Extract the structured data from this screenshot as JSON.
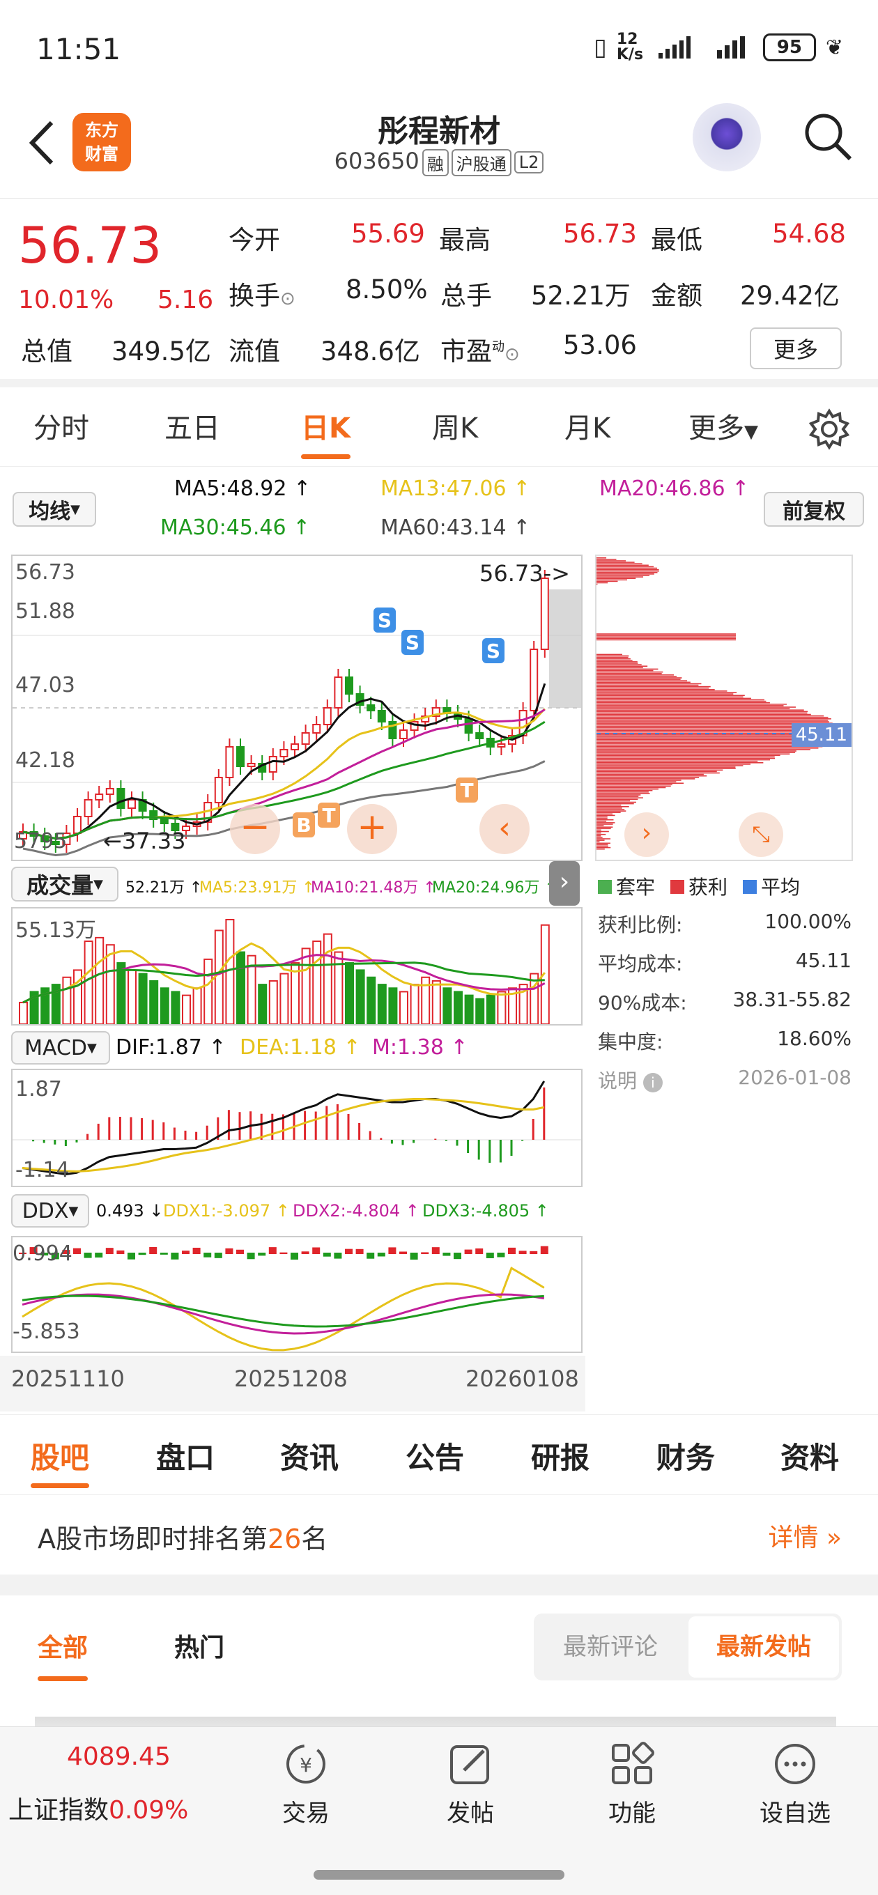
{
  "status": {
    "time": "11:51",
    "net_speed": "12 K/s",
    "battery": "95"
  },
  "header": {
    "logo_line1": "东方",
    "logo_line2": "财富",
    "name": "彤程新材",
    "code": "603650",
    "tags": [
      "融",
      "沪股通",
      "L2"
    ]
  },
  "quote": {
    "price": "56.73",
    "pct": "10.01%",
    "change": "5.16",
    "items": [
      {
        "label": "今开",
        "value": "55.69",
        "color": "red"
      },
      {
        "label": "最高",
        "value": "56.73",
        "color": "red"
      },
      {
        "label": "最低",
        "value": "54.68",
        "color": "red"
      },
      {
        "label": "换手",
        "value": "8.50%",
        "color": "dark"
      },
      {
        "label": "总手",
        "value": "52.21万",
        "color": "dark"
      },
      {
        "label": "金额",
        "value": "29.42亿",
        "color": "dark"
      },
      {
        "label": "总值",
        "value": "349.5亿",
        "color": "dark"
      },
      {
        "label": "流值",
        "value": "348.6亿",
        "color": "dark"
      },
      {
        "label": "市盈",
        "value": "53.06",
        "color": "dark"
      }
    ],
    "pe_sup": "动",
    "more_btn": "更多"
  },
  "tabs": [
    "分时",
    "五日",
    "日K",
    "周K",
    "月K",
    "更多"
  ],
  "active_tab": "日K",
  "ma": {
    "selector": "均线",
    "ma5": "MA5:48.92 ↑",
    "ma13": "MA13:47.06 ↑",
    "ma20": "MA20:46.86 ↑",
    "ma30": "MA30:45.46 ↑",
    "ma60": "MA60:43.14 ↑",
    "adjust": "前复权"
  },
  "kline": {
    "y_labels": [
      "56.73",
      "51.88",
      "47.03",
      "42.18",
      "37.33"
    ],
    "last_label": "56.73->",
    "low_label": "37.33",
    "left_cut": "5795",
    "signals": [
      "S",
      "S",
      "S",
      "B",
      "T",
      "T"
    ]
  },
  "chip": {
    "avg_label": "45.11",
    "legend": [
      "套牢",
      "获利",
      "平均"
    ],
    "rows": [
      {
        "label": "获利比例:",
        "value": "100.00%"
      },
      {
        "label": "平均成本:",
        "value": "45.11"
      },
      {
        "label": "90%成本:",
        "value": "38.31-55.82"
      },
      {
        "label": "集中度:",
        "value": "18.60%"
      }
    ],
    "note_label": "说明",
    "note_date": "2026-01-08"
  },
  "volume": {
    "selector": "成交量",
    "v": "52.21万 ↑",
    "ma5": "MA5:23.91万 ↑",
    "ma10": "MA10:21.48万 ↑",
    "ma20": "MA20:24.96万 ↑",
    "max": "55.13万"
  },
  "macd": {
    "selector": "MACD",
    "dif": "DIF:1.87 ↑",
    "dea": "DEA:1.18 ↑",
    "m": "M:1.38 ↑",
    "top": "1.87",
    "bottom": "-1.14"
  },
  "ddx": {
    "selector": "DDX",
    "v": "0.493 ↓",
    "d1": "DDX1:-3.097 ↑",
    "d2": "DDX2:-4.804 ↑",
    "d3": "DDX3:-4.805 ↑",
    "top": "0.994",
    "bottom": "-5.853"
  },
  "dates": [
    "20251110",
    "20251208",
    "20260108"
  ],
  "subtabs": [
    "股吧",
    "盘口",
    "资讯",
    "公告",
    "研报",
    "财务",
    "资料"
  ],
  "rank": {
    "prefix": "A股市场即时排名第",
    "num": "26",
    "suffix": "名",
    "detail": "详情"
  },
  "feed": {
    "tabs": [
      "全部",
      "热门"
    ],
    "sort": [
      "最新评论",
      "最新发帖"
    ]
  },
  "bottom": {
    "index_value": "4089.45",
    "index_name": "上证指数",
    "index_pct": "0.09%",
    "nav": [
      "交易",
      "发帖",
      "功能",
      "设自选"
    ]
  },
  "colors": {
    "up": "#e0252b",
    "down": "#1e9a1e",
    "accent": "#f36b1c",
    "ma5": "#111111",
    "ma13": "#e6c21a",
    "ma20": "#c21f9a",
    "ma30": "#1e9a1e",
    "ma60": "#777777"
  }
}
